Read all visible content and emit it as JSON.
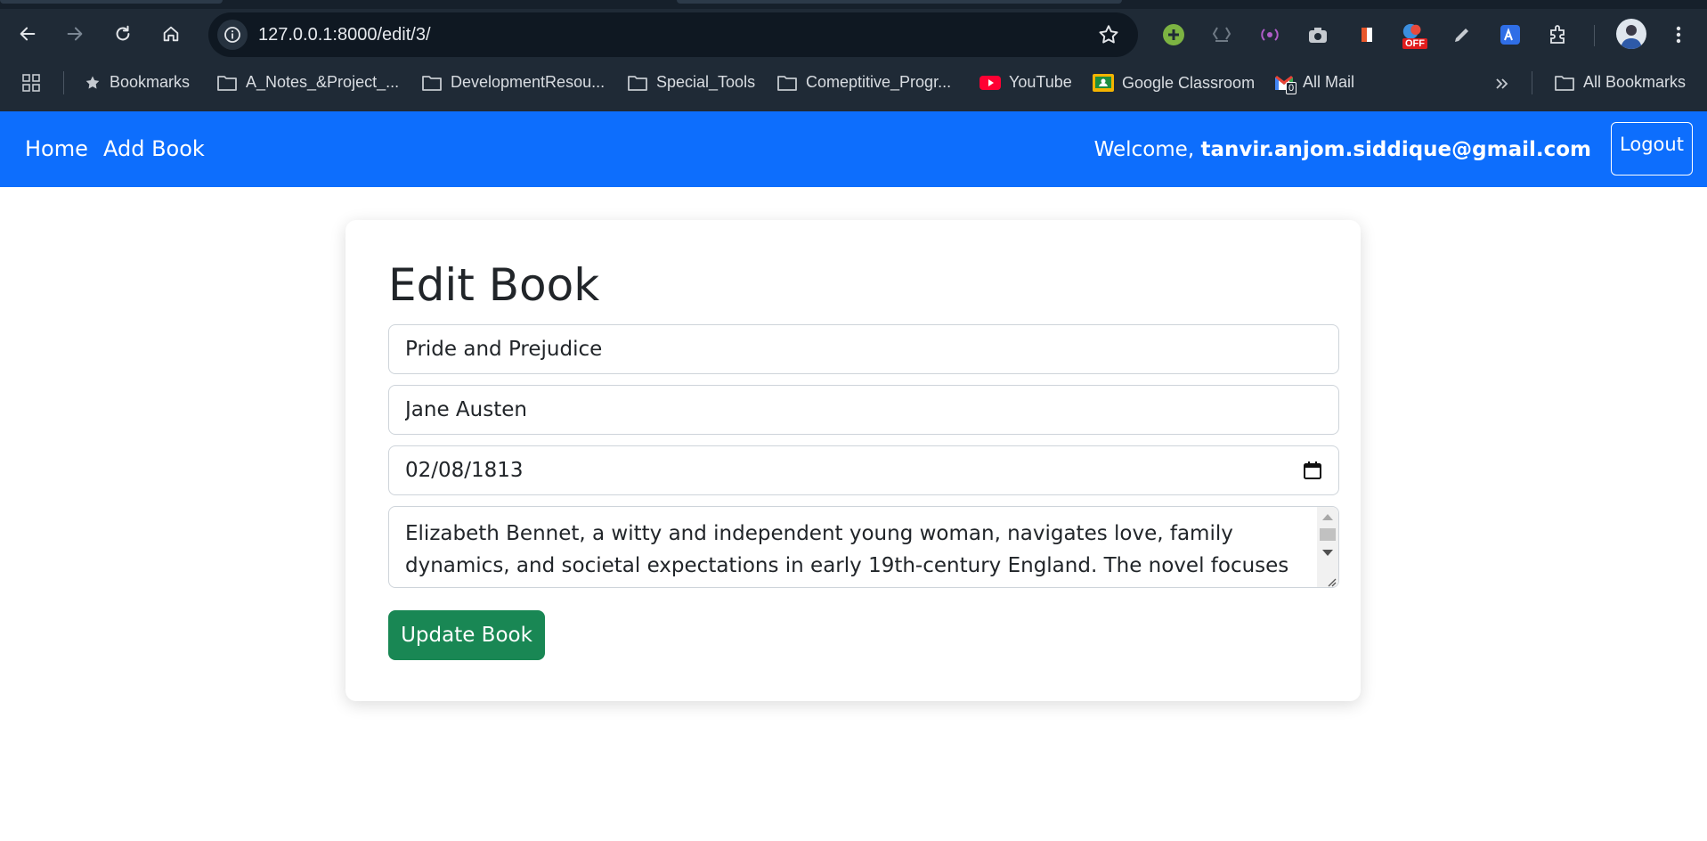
{
  "browser": {
    "url": "127.0.0.1:8000/edit/3/",
    "bookmarks": [
      {
        "label": "Bookmarks",
        "icon": "star-icon"
      },
      {
        "label": "A_Notes_&Project_...",
        "icon": "folder-icon"
      },
      {
        "label": "DevelopmentResou...",
        "icon": "folder-icon"
      },
      {
        "label": "Special_Tools",
        "icon": "folder-icon"
      },
      {
        "label": "Comeptitive_Progr...",
        "icon": "folder-icon"
      },
      {
        "label": "YouTube",
        "icon": "youtube-icon"
      },
      {
        "label": "Google Classroom",
        "icon": "classroom-icon"
      },
      {
        "label": "All Mail",
        "icon": "gmail-icon"
      }
    ],
    "all_bookmarks": "All Bookmarks",
    "ext_badge": "OFF",
    "mail_badge": "0"
  },
  "navbar": {
    "home": "Home",
    "add_book": "Add Book",
    "welcome_prefix": "Welcome, ",
    "user_email": "tanvir.anjom.siddique@gmail.com",
    "logout": "Logout"
  },
  "form": {
    "heading": "Edit Book",
    "title_value": "Pride and Prejudice",
    "author_value": "Jane Austen",
    "published_date": "02/08/1813",
    "description": "Elizabeth Bennet, a witty and independent young woman, navigates love, family dynamics, and societal expectations in early 19th-century England. The novel focuses on her evolving",
    "submit": "Update Book"
  },
  "colors": {
    "navbar": "#0d6efd",
    "submit": "#198754",
    "chrome": "#1f2a36"
  }
}
